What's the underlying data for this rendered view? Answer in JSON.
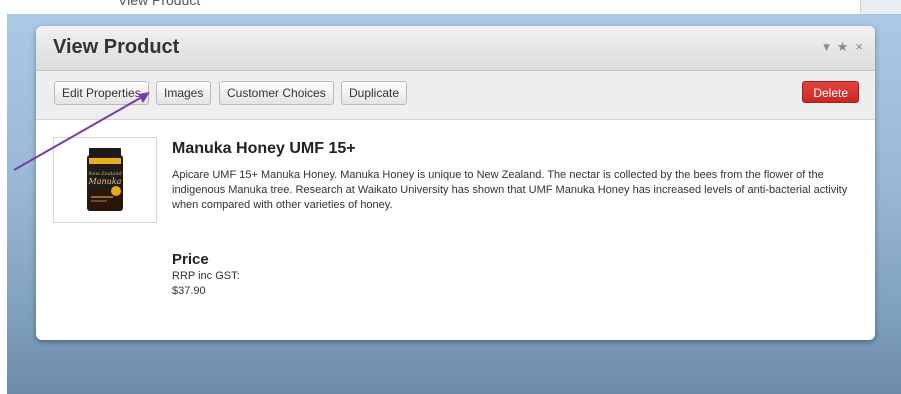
{
  "page_top_text": "View Product",
  "modal": {
    "title": "View Product",
    "controls": {
      "collapse": "▾",
      "favorite": "★",
      "close": "×"
    }
  },
  "toolbar": {
    "edit_label": "Edit Properties",
    "images_label": "Images",
    "choices_label": "Customer Choices",
    "duplicate_label": "Duplicate",
    "delete_label": "Delete"
  },
  "product": {
    "name": "Manuka Honey UMF 15+",
    "description": "Apicare UMF 15+ Manuka Honey. Manuka Honey is unique to New Zealand. The nectar is collected by the bees from the flower of the indigenous Manuka tree. Research at Waikato University has shown that UMF Manuka Honey has increased levels of anti-bacterial activity when compared with other varieties of honey.",
    "image_alt": "Manuka Honey jar"
  },
  "price": {
    "heading": "Price",
    "label": "RRP inc GST:",
    "value": "$37.90"
  },
  "colors": {
    "delete_button": "#d0302a",
    "annotation_arrow": "#7a3aa8"
  }
}
